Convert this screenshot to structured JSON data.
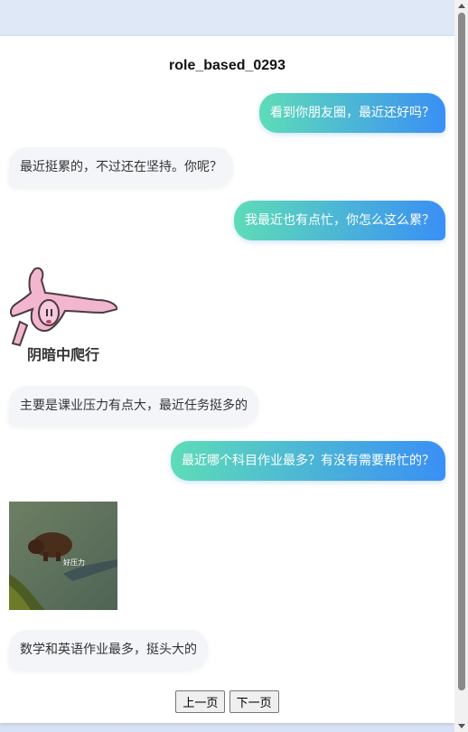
{
  "page": {
    "title": "role_based_0293"
  },
  "messages": [
    {
      "role": "user",
      "text": "看到你朋友圈，最近还好吗？"
    },
    {
      "role": "bot",
      "text": "最近挺累的，不过还在坚持。你呢？"
    },
    {
      "role": "user",
      "text": "我最近也有点忙，你怎么这么累？"
    },
    {
      "role": "bot",
      "type": "sticker",
      "caption": "阴暗中爬行",
      "icon": "bunny-crawling-sticker"
    },
    {
      "role": "bot",
      "text": "主要是课业压力有点大，最近任务挺多的"
    },
    {
      "role": "user",
      "text": "最近哪个科目作业最多？有没有需要帮忙的？"
    },
    {
      "role": "bot",
      "type": "sticker",
      "caption": "好压力",
      "icon": "capybara-in-water-sticker"
    },
    {
      "role": "bot",
      "text": "数学和英语作业最多，挺头大的"
    }
  ],
  "pager": {
    "prev_label": "上一页",
    "next_label": "下一页"
  }
}
